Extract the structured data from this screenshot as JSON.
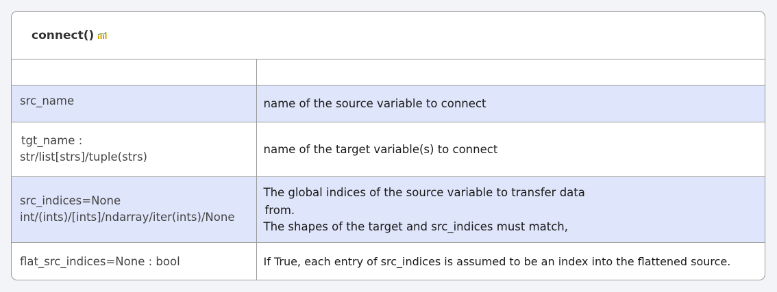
{
  "card": {
    "title": "connect()",
    "title_icon": "chart-icon"
  },
  "rows": [
    {
      "name": "",
      "desc": ""
    },
    {
      "name": "src_name",
      "desc": "name of the source variable to connect"
    },
    {
      "name_line1": "tgt_name :",
      "name_line2": "str/list[strs]/tuple(strs)",
      "desc": "name of the target variable(s) to connect"
    },
    {
      "name_line1": "src_indices=None",
      "name_line2": "int/(ints)/[ints]/ndarray/iter(ints)/None",
      "desc_line1": "The global indices of the source variable to transfer data",
      "desc_line2": "from.",
      "desc_line3": "The shapes of the target and src_indices must match,"
    },
    {
      "name": "flat_src_indices=None : bool",
      "desc": "If True, each entry of src_indices is assumed to be an index into the flattened source."
    }
  ],
  "colors": {
    "row_shade": "#dfe5fa",
    "border": "#9a9a9a",
    "background": "#f3f4f8"
  }
}
